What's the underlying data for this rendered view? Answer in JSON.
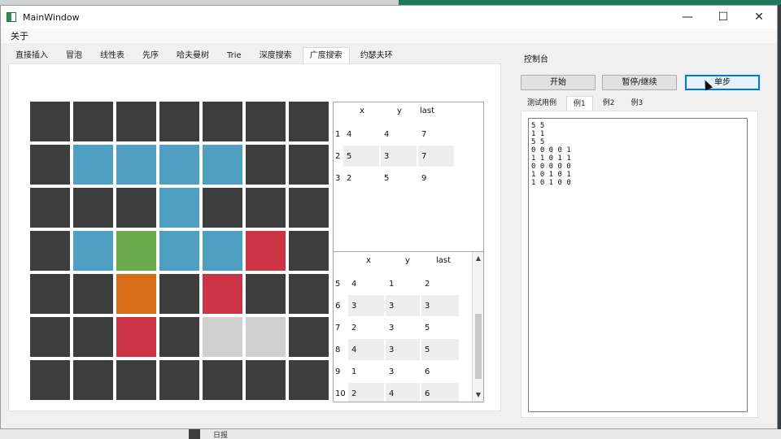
{
  "window": {
    "title": "MainWindow",
    "controls": {
      "minimize": "—",
      "maximize": "☐",
      "close": "✕"
    }
  },
  "menu": {
    "about": "关于"
  },
  "tabs": [
    "直接插入",
    "冒泡",
    "线性表",
    "先序",
    "哈夫曼树",
    "Trie",
    "深度搜索",
    "广度搜索",
    "约瑟夫环"
  ],
  "active_tab": 7,
  "maze": {
    "colors": {
      "wall": "#3d3d3d",
      "visited": "#4e9fc1",
      "start": "#6aaa4c",
      "current": "#d86e1a",
      "queued": "#cc3445",
      "empty": "#cfcfcf"
    },
    "rows": [
      [
        "wall",
        "wall",
        "wall",
        "wall",
        "wall",
        "wall",
        "wall"
      ],
      [
        "wall",
        "visited",
        "visited",
        "visited",
        "visited",
        "wall",
        "wall"
      ],
      [
        "wall",
        "wall",
        "wall",
        "visited",
        "wall",
        "wall",
        "wall"
      ],
      [
        "wall",
        "visited",
        "start",
        "visited",
        "visited",
        "queued",
        "wall"
      ],
      [
        "wall",
        "wall",
        "current",
        "wall",
        "queued",
        "wall",
        "wall"
      ],
      [
        "wall",
        "wall",
        "queued",
        "wall",
        "empty",
        "empty",
        "wall"
      ],
      [
        "wall",
        "wall",
        "wall",
        "wall",
        "wall",
        "wall",
        "wall"
      ]
    ]
  },
  "table_top": {
    "headers": [
      "x",
      "y",
      "last"
    ],
    "rows": [
      {
        "num": "1",
        "x": "4",
        "y": "4",
        "last": "7"
      },
      {
        "num": "2",
        "x": "5",
        "y": "3",
        "last": "7"
      },
      {
        "num": "3",
        "x": "2",
        "y": "5",
        "last": "9"
      }
    ]
  },
  "table_bottom": {
    "headers": [
      "x",
      "y",
      "last"
    ],
    "rows": [
      {
        "num": "5",
        "x": "4",
        "y": "1",
        "last": "2"
      },
      {
        "num": "6",
        "x": "3",
        "y": "3",
        "last": "3"
      },
      {
        "num": "7",
        "x": "2",
        "y": "3",
        "last": "5"
      },
      {
        "num": "8",
        "x": "4",
        "y": "3",
        "last": "5"
      },
      {
        "num": "9",
        "x": "1",
        "y": "3",
        "last": "6"
      },
      {
        "num": "10",
        "x": "2",
        "y": "4",
        "last": "6"
      }
    ],
    "scroll_up": "▲",
    "scroll_down": "▼"
  },
  "control_panel": {
    "title": "控制台",
    "buttons": {
      "start": "开始",
      "pause": "暂停/继续",
      "step": "单步"
    },
    "subtabs": [
      "测试用例",
      "例1",
      "例2",
      "例3"
    ],
    "active_subtab": 1,
    "input_text": "5 5\n1 1\n5 5\n0 0 0 0 1\n1 1 0 1 1\n0 0 0 0 0\n1 0 1 0 1\n1 0 1 0 0"
  },
  "taskbar": {
    "bottom_label": "日报"
  }
}
